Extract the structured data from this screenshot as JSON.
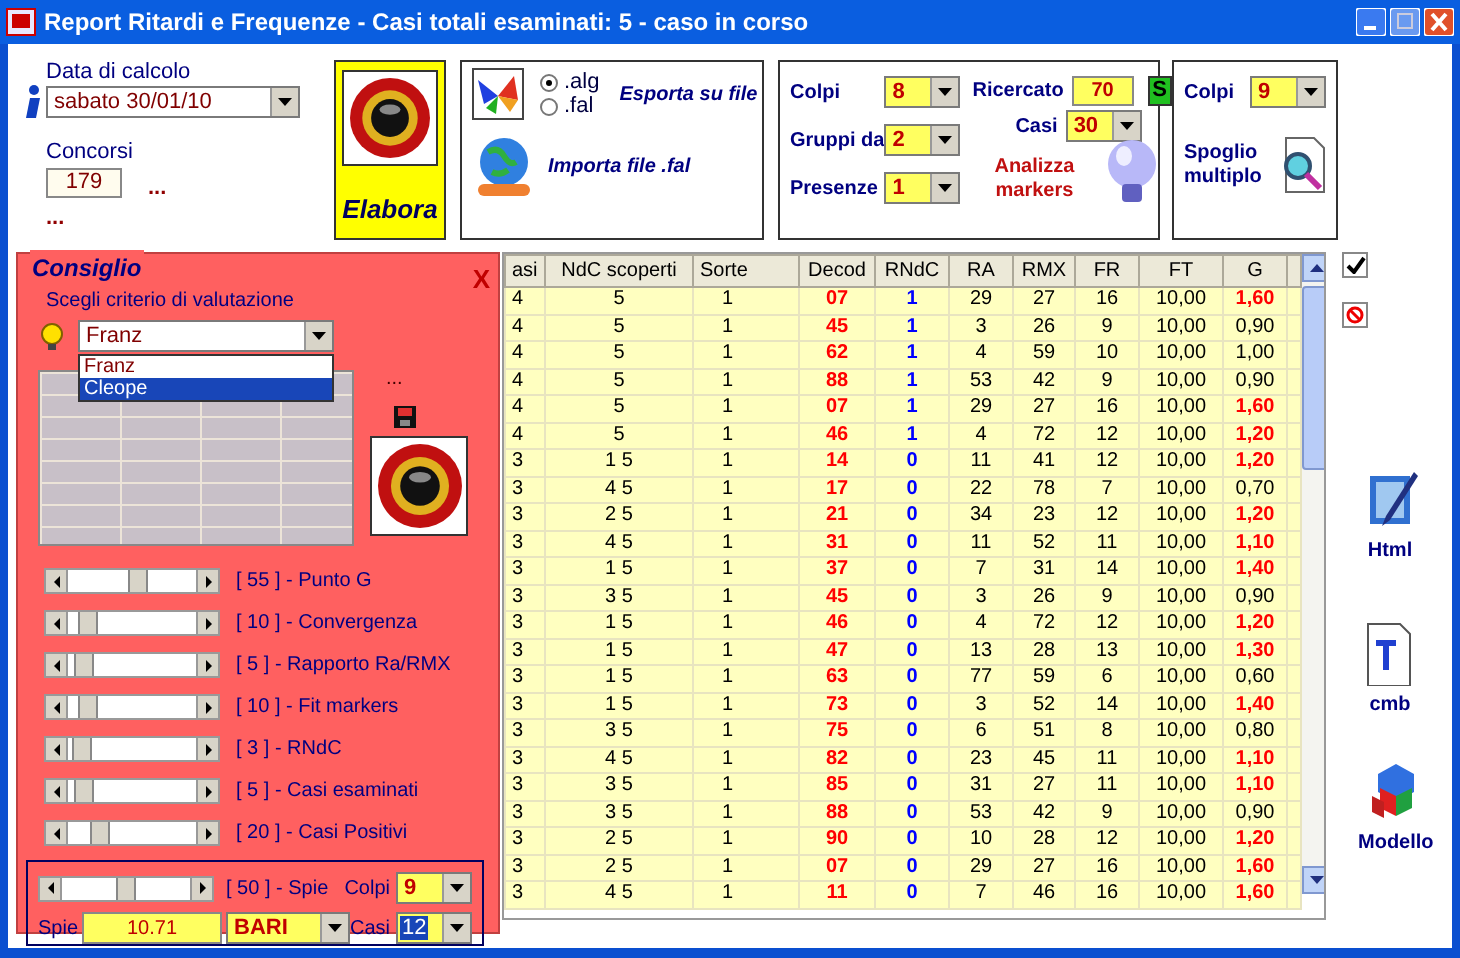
{
  "window": {
    "title": "Report Ritardi e Frequenze - Casi totali esaminati: 5 - caso in corso"
  },
  "date": {
    "label": "Data di calcolo",
    "value": "sabato 30/01/10"
  },
  "concorsi": {
    "label": "Concorsi",
    "value": "179",
    "link": "...",
    "link_2": "..."
  },
  "elabora": {
    "label": "Elabora"
  },
  "export": {
    "formats": [
      {
        "label": ".alg",
        "selected": true
      },
      {
        "label": ".fal",
        "selected": false
      }
    ],
    "export_label": "Esporta su file",
    "import_label": "Importa file .fal"
  },
  "markers": {
    "fields": [
      {
        "label": "Colpi",
        "value": "8"
      },
      {
        "label": "Gruppi da",
        "value": "2"
      },
      {
        "label": "Presenze",
        "value": "1"
      }
    ],
    "ricercato": {
      "label": "Ricercato",
      "value": "70",
      "flag": "S"
    },
    "casi": {
      "label": "Casi",
      "value": "30"
    },
    "analyze_label": "Analizza markers"
  },
  "spoglio": {
    "colpi_label": "Colpi",
    "colpi_value": "9",
    "label": "Spoglio multiplo"
  },
  "consiglio": {
    "title": "Consiglio",
    "close": "X",
    "criterion_label": "Scegli criterio di valutazione",
    "criterion_value": "Franz",
    "options": [
      {
        "label": "Franz",
        "selected": false
      },
      {
        "label": "Cleope",
        "selected": true
      }
    ],
    "dots": "...",
    "weights": [
      {
        "label": "[ 55 ] - Punto G",
        "level": 0.55
      },
      {
        "label": "[ 10 ] - Convergenza",
        "level": 0.1
      },
      {
        "label": "[ 5 ] - Rapporto Ra/RMX",
        "level": 0.05
      },
      {
        "label": "[ 10 ] - Fit markers",
        "level": 0.1
      },
      {
        "label": "[ 3 ] - RNdC",
        "level": 0.03
      },
      {
        "label": "[ 5 ] - Casi esaminati",
        "level": 0.05
      },
      {
        "label": "[ 20 ] - Casi Positivi",
        "level": 0.2
      }
    ],
    "spie": {
      "label": "[ 50 ] - Spie",
      "level": 0.5,
      "colpi_label": "Colpi",
      "colpi_value": "9",
      "spie_label": "Spie",
      "spie_value": "10.71",
      "wheel": "BARI",
      "casi_label": "Casi",
      "casi_value": "12"
    }
  },
  "table": {
    "columns": [
      "asi",
      "NdC scoperti",
      "Sorte",
      "Decod",
      "RNdC",
      "RA",
      "RMX",
      "FR",
      "FT",
      "G"
    ],
    "rows": [
      {
        "cells": [
          "4",
          "5",
          "1",
          "07",
          "1",
          "29",
          "27",
          "16",
          "10,00",
          "1,60"
        ],
        "g_high": true
      },
      {
        "cells": [
          "4",
          "5",
          "1",
          "45",
          "1",
          "3",
          "26",
          "9",
          "10,00",
          "0,90"
        ],
        "g_high": false
      },
      {
        "cells": [
          "4",
          "5",
          "1",
          "62",
          "1",
          "4",
          "59",
          "10",
          "10,00",
          "1,00"
        ],
        "g_high": false
      },
      {
        "cells": [
          "4",
          "5",
          "1",
          "88",
          "1",
          "53",
          "42",
          "9",
          "10,00",
          "0,90"
        ],
        "g_high": false
      },
      {
        "cells": [
          "4",
          "5",
          "1",
          "07",
          "1",
          "29",
          "27",
          "16",
          "10,00",
          "1,60"
        ],
        "g_high": true
      },
      {
        "cells": [
          "4",
          "5",
          "1",
          "46",
          "1",
          "4",
          "72",
          "12",
          "10,00",
          "1,20"
        ],
        "g_high": true
      },
      {
        "cells": [
          "3",
          "1 5",
          "1",
          "14",
          "0",
          "11",
          "41",
          "12",
          "10,00",
          "1,20"
        ],
        "g_high": true
      },
      {
        "cells": [
          "3",
          "4 5",
          "1",
          "17",
          "0",
          "22",
          "78",
          "7",
          "10,00",
          "0,70"
        ],
        "g_high": false
      },
      {
        "cells": [
          "3",
          "2 5",
          "1",
          "21",
          "0",
          "34",
          "23",
          "12",
          "10,00",
          "1,20"
        ],
        "g_high": true
      },
      {
        "cells": [
          "3",
          "4 5",
          "1",
          "31",
          "0",
          "11",
          "52",
          "11",
          "10,00",
          "1,10"
        ],
        "g_high": true
      },
      {
        "cells": [
          "3",
          "1 5",
          "1",
          "37",
          "0",
          "7",
          "31",
          "14",
          "10,00",
          "1,40"
        ],
        "g_high": true
      },
      {
        "cells": [
          "3",
          "3 5",
          "1",
          "45",
          "0",
          "3",
          "26",
          "9",
          "10,00",
          "0,90"
        ],
        "g_high": false
      },
      {
        "cells": [
          "3",
          "1 5",
          "1",
          "46",
          "0",
          "4",
          "72",
          "12",
          "10,00",
          "1,20"
        ],
        "g_high": true
      },
      {
        "cells": [
          "3",
          "1 5",
          "1",
          "47",
          "0",
          "13",
          "28",
          "13",
          "10,00",
          "1,30"
        ],
        "g_high": true
      },
      {
        "cells": [
          "3",
          "1 5",
          "1",
          "63",
          "0",
          "77",
          "59",
          "6",
          "10,00",
          "0,60"
        ],
        "g_high": false
      },
      {
        "cells": [
          "3",
          "1 5",
          "1",
          "73",
          "0",
          "3",
          "52",
          "14",
          "10,00",
          "1,40"
        ],
        "g_high": true
      },
      {
        "cells": [
          "3",
          "3 5",
          "1",
          "75",
          "0",
          "6",
          "51",
          "8",
          "10,00",
          "0,80"
        ],
        "g_high": false
      },
      {
        "cells": [
          "3",
          "4 5",
          "1",
          "82",
          "0",
          "23",
          "45",
          "11",
          "10,00",
          "1,10"
        ],
        "g_high": true
      },
      {
        "cells": [
          "3",
          "3 5",
          "1",
          "85",
          "0",
          "31",
          "27",
          "11",
          "10,00",
          "1,10"
        ],
        "g_high": true
      },
      {
        "cells": [
          "3",
          "3 5",
          "1",
          "88",
          "0",
          "53",
          "42",
          "9",
          "10,00",
          "0,90"
        ],
        "g_high": false
      },
      {
        "cells": [
          "3",
          "2 5",
          "1",
          "90",
          "0",
          "10",
          "28",
          "12",
          "10,00",
          "1,20"
        ],
        "g_high": true
      },
      {
        "cells": [
          "3",
          "2 5",
          "1",
          "07",
          "0",
          "29",
          "27",
          "16",
          "10,00",
          "1,60"
        ],
        "g_high": true
      },
      {
        "cells": [
          "3",
          "4 5",
          "1",
          "11",
          "0",
          "7",
          "46",
          "16",
          "10,00",
          "1,60"
        ],
        "g_high": true
      }
    ]
  },
  "side_tools": [
    {
      "label": "Html"
    },
    {
      "label": "cmb"
    },
    {
      "label": "Modello"
    }
  ]
}
